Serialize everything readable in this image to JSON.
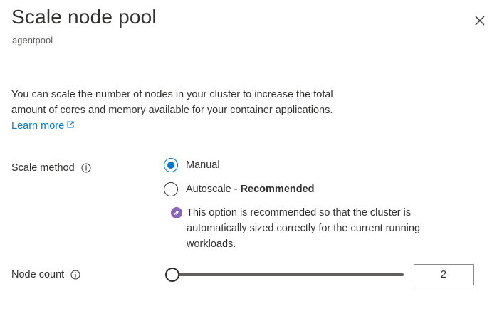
{
  "header": {
    "title": "Scale node pool",
    "subtitle": "agentpool",
    "close_icon": "close-icon"
  },
  "description": {
    "text": "You can scale the number of nodes in your cluster to increase the total amount of cores and memory available for your container applications. ",
    "link_text": "Learn more",
    "link_icon": "external-link-icon"
  },
  "scale_method": {
    "label": "Scale method",
    "options": [
      {
        "label": "Manual",
        "checked": true
      },
      {
        "label": "Autoscale",
        "suffix": " - ",
        "emphasis": "Recommended",
        "checked": false
      }
    ],
    "recommendation": "This option is recommended so that the cluster is automatically sized correctly for the current running workloads.",
    "recommendation_icon": "rocket-icon"
  },
  "node_count": {
    "label": "Node count",
    "value": "2"
  },
  "colors": {
    "accent": "#0078d4",
    "rocket_badge": "#8764b8"
  }
}
